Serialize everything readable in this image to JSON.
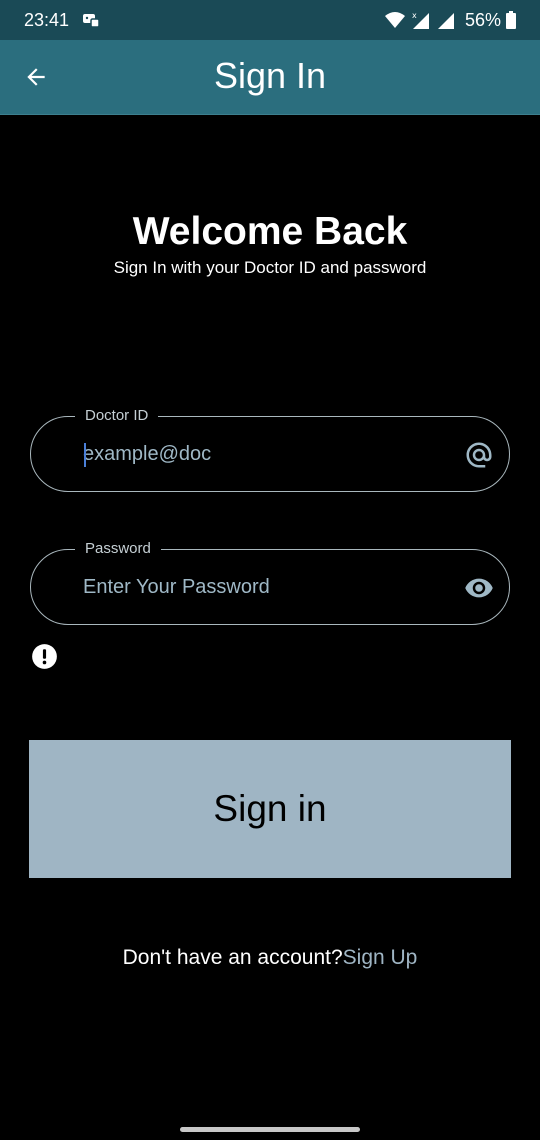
{
  "status_bar": {
    "time": "23:41",
    "battery": "56%"
  },
  "app_bar": {
    "title": "Sign In",
    "back_icon": "arrow-back-icon"
  },
  "welcome": {
    "title": "Welcome Back",
    "subtitle": "Sign In with your Doctor ID and password"
  },
  "doctor_id_field": {
    "label": "Doctor ID",
    "placeholder": "example@doc",
    "value": "",
    "icon": "at-sign-icon"
  },
  "password_field": {
    "label": "Password",
    "placeholder": "Enter Your Password",
    "value": "",
    "icon": "eye-icon"
  },
  "error_icon": "exclamation-circle-icon",
  "signin_button": {
    "label": "Sign in"
  },
  "signup": {
    "prompt": "Don't have an account?",
    "link": "Sign Up"
  },
  "colors": {
    "status_bar": "#1a4a56",
    "app_bar": "#2b6e7e",
    "button": "#9fb5c4",
    "link": "#9fb5c4",
    "background": "#000000"
  }
}
